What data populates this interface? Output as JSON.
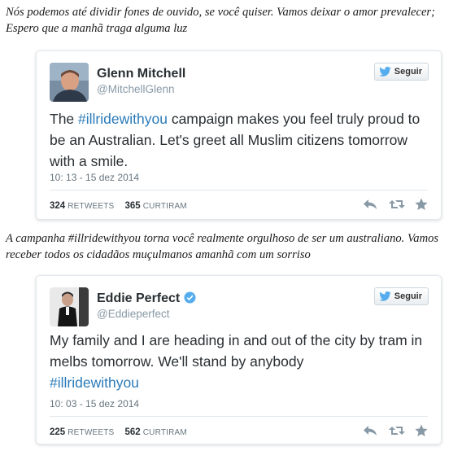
{
  "captions": {
    "first": "Nós podemos até dividir fones de ouvido, se você quiser. Vamos deixar o amor prevalecer; Espero que a manhã traga alguma luz",
    "second": "A campanha #illridewithyou torna você realmente orgulhoso de ser um australiano. Vamos receber todos os cidadãos muçulmanos amanhã com um sorriso"
  },
  "tweets": [
    {
      "name": "Glenn Mitchell",
      "handle": "@MitchellGlenn",
      "follow_label": "Seguir",
      "text_before": "The ",
      "hashtag": "#illridewithyou",
      "text_after": " campaign makes you feel truly proud to be an Australian. Let's greet all Muslim citizens tomorrow with a smile.",
      "datetime": "10: 13 - 15 dez 2014",
      "retweets": "324",
      "retweets_label": "RETWEETS",
      "likes": "365",
      "likes_label": "CURTIRAM"
    },
    {
      "name": "Eddie Perfect",
      "handle": "@Eddieperfect",
      "follow_label": "Seguir",
      "text_before": "My family and I are heading in and out of the city by tram in melbs tomorrow. We'll stand by anybody",
      "hashtag": "#illridewithyou",
      "text_after": "",
      "datetime": "10: 03 - 15 dez 2014",
      "retweets": "225",
      "retweets_label": "RETWEETS",
      "likes": "562",
      "likes_label": "CURTIRAM"
    }
  ],
  "icons": [
    "twitter-bird-icon",
    "verified-badge-icon",
    "reply-icon",
    "retweet-icon",
    "favorite-star-icon"
  ],
  "colors": {
    "hashtag": "#2b7bb9",
    "verified": "#55acee",
    "twitter_blue": "#55acee",
    "action_gray": "#8899a6"
  }
}
